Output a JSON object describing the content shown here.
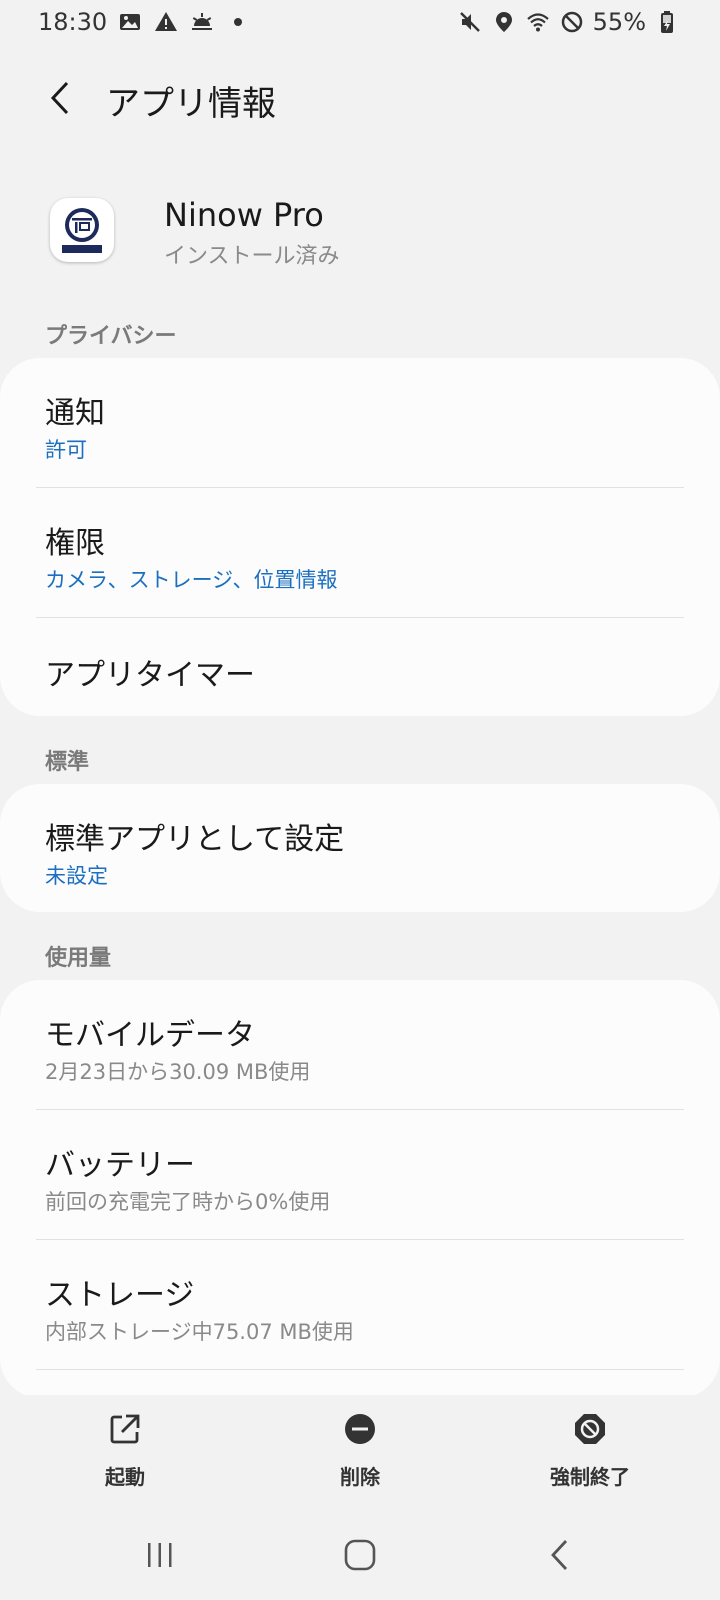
{
  "status_bar": {
    "time": "18:30",
    "left_icons": [
      "image-icon",
      "warning-icon",
      "weather-icon",
      "dot-icon"
    ],
    "right_icons": [
      "mute-icon",
      "location-icon",
      "wifi-icon",
      "do-not-disturb-icon"
    ],
    "battery": "55%"
  },
  "header": {
    "title": "アプリ情報"
  },
  "app": {
    "name": "Ninow Pro",
    "status": "インストール済み"
  },
  "sections": {
    "privacy": {
      "label": "プライバシー",
      "items": [
        {
          "title": "通知",
          "subtitle": "許可"
        },
        {
          "title": "権限",
          "subtitle": "カメラ、ストレージ、位置情報"
        },
        {
          "title": "アプリタイマー"
        }
      ]
    },
    "default": {
      "label": "標準",
      "items": [
        {
          "title": "標準アプリとして設定",
          "subtitle": "未設定"
        }
      ]
    },
    "usage": {
      "label": "使用量",
      "items": [
        {
          "title": "モバイルデータ",
          "subtitle": "2月23日から30.09 MB使用"
        },
        {
          "title": "バッテリー",
          "subtitle": "前回の充電完了時から0%使用"
        },
        {
          "title": "ストレージ",
          "subtitle": "内部ストレージ中75.07 MB使用"
        }
      ]
    }
  },
  "actions": {
    "open": "起動",
    "uninstall": "削除",
    "force_stop": "強制終了"
  },
  "colors": {
    "accent": "#1c6fc0",
    "background": "#f2f2f2",
    "card": "#fcfcfc"
  }
}
